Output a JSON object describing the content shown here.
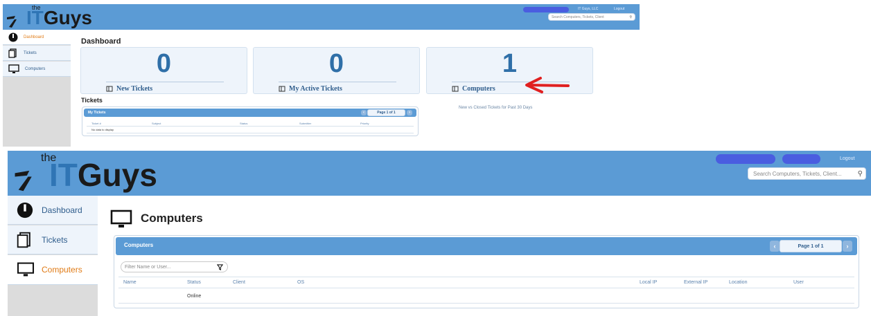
{
  "dashboard_view": {
    "logo": {
      "prefix": "the",
      "brand_it": "IT",
      "brand_guys": "Guys"
    },
    "header": {
      "user_menu": "IT Guys, LLC",
      "logout": "Logout",
      "search_placeholder": "Search Computers, Tickets, Client"
    },
    "sidebar": [
      {
        "label": "Dashboard",
        "icon": "speedometer-icon",
        "active": true
      },
      {
        "label": "Tickets",
        "icon": "document-icon",
        "active": false
      },
      {
        "label": "Computers",
        "icon": "monitor-icon",
        "active": false
      }
    ],
    "page_title": "Dashboard",
    "tiles": [
      {
        "value": "0",
        "label": "New Tickets"
      },
      {
        "value": "0",
        "label": "My Active Tickets"
      },
      {
        "value": "1",
        "label": "Computers"
      }
    ],
    "tickets_section_title": "Tickets",
    "tickets_grid": {
      "title": "My Tickets",
      "pager": "Page 1 of 1",
      "columns": [
        "Ticket #",
        "Subject",
        "Status",
        "Submitter",
        "Priority"
      ],
      "empty_message": "No data to display"
    },
    "chart_caption": "New vs Closed Tickets for Past 30 Days",
    "annotation_color": "#e02020"
  },
  "computers_view": {
    "logo": {
      "prefix": "the",
      "brand_it": "IT",
      "brand_guys": "Guys"
    },
    "header": {
      "logout": "Logout",
      "search_placeholder": "Search Computers, Tickets, Client..."
    },
    "sidebar": [
      {
        "label": "Dashboard",
        "icon": "speedometer-icon",
        "active": false
      },
      {
        "label": "Tickets",
        "icon": "document-icon",
        "active": false
      },
      {
        "label": "Computers",
        "icon": "monitor-icon",
        "active": true
      }
    ],
    "page_title": "Computers",
    "grid": {
      "title": "Computers",
      "pager": "Page 1 of 1",
      "filter_placeholder": "Filter Name or User...",
      "columns": [
        "Name",
        "Status",
        "Client",
        "OS",
        "Local IP",
        "External IP",
        "Location",
        "User"
      ],
      "rows": [
        {
          "status": "Online"
        }
      ]
    }
  },
  "colors": {
    "header_blue": "#5b9bd5",
    "active_orange": "#e07b16",
    "tile_number": "#2f6fa8"
  }
}
